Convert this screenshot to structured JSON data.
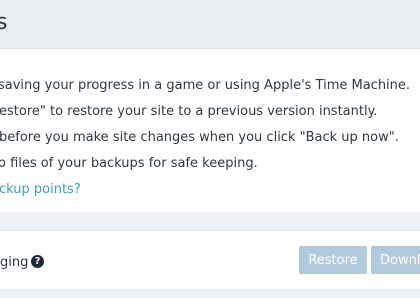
{
  "page": {
    "title": "s"
  },
  "info": {
    "lines": [
      "saving your progress in a game or using Apple's Time Machine.",
      "estore\" to restore your site to a previous version instantly.",
      "before you make site changes when you click \"Back up now\".",
      "o files of your backups for safe keeping."
    ],
    "link": "ckup points?"
  },
  "backup": {
    "site_label": "ging",
    "help_icon": "?",
    "restore_label": "Restore",
    "download_label": "Downl"
  }
}
